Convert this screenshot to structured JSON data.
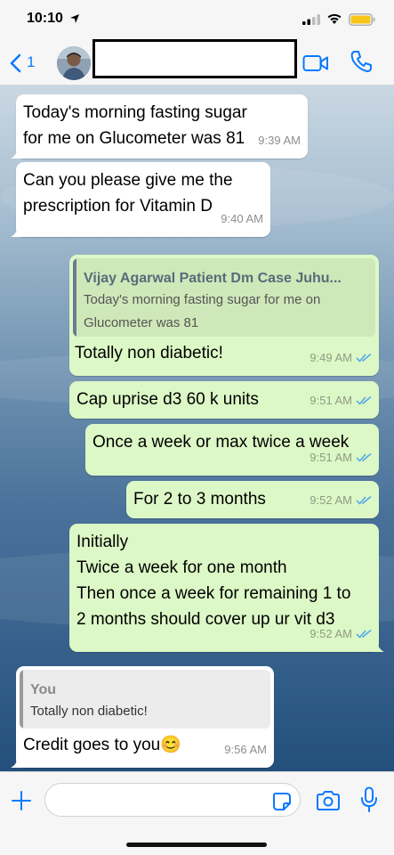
{
  "status_bar": {
    "time": "10:10"
  },
  "header": {
    "back_count": "1",
    "contact_name": ""
  },
  "messages": [
    {
      "type": "incoming",
      "text": "Today's morning fasting sugar for me on Glucometer was 81",
      "time": "9:39 AM"
    },
    {
      "type": "incoming",
      "text": "Can you please give me the prescription for Vitamin D",
      "time": "9:40 AM"
    },
    {
      "type": "outgoing",
      "quote_author": "Vijay Agarwal Patient Dm Case Juhu...",
      "quote_text": "Today's morning fasting sugar for me on Glucometer was 81",
      "text": "Totally non diabetic!",
      "time": "9:49 AM"
    },
    {
      "type": "outgoing",
      "text": "Cap uprise d3 60 k units",
      "time": "9:51 AM"
    },
    {
      "type": "outgoing",
      "text": "Once a week or max twice a week",
      "time": "9:51 AM"
    },
    {
      "type": "outgoing",
      "text": "For 2 to 3 months",
      "time": "9:52 AM"
    },
    {
      "type": "outgoing",
      "lines": [
        "Initially",
        "Twice a week for one month",
        "Then once a week for remaining 1 to",
        "2 months should cover up ur vit d3"
      ],
      "time": "9:52 AM"
    },
    {
      "type": "incoming",
      "quote_author": "You",
      "quote_text": "Totally non diabetic!",
      "text": "Credit goes to you",
      "emoji": "😊",
      "time": "9:56 AM"
    }
  ],
  "colors": {
    "accent": "#0a7aff",
    "outgoing_bubble": "#dcf8c6",
    "incoming_bubble": "#ffffff",
    "read_tick": "#4fa6e8"
  }
}
